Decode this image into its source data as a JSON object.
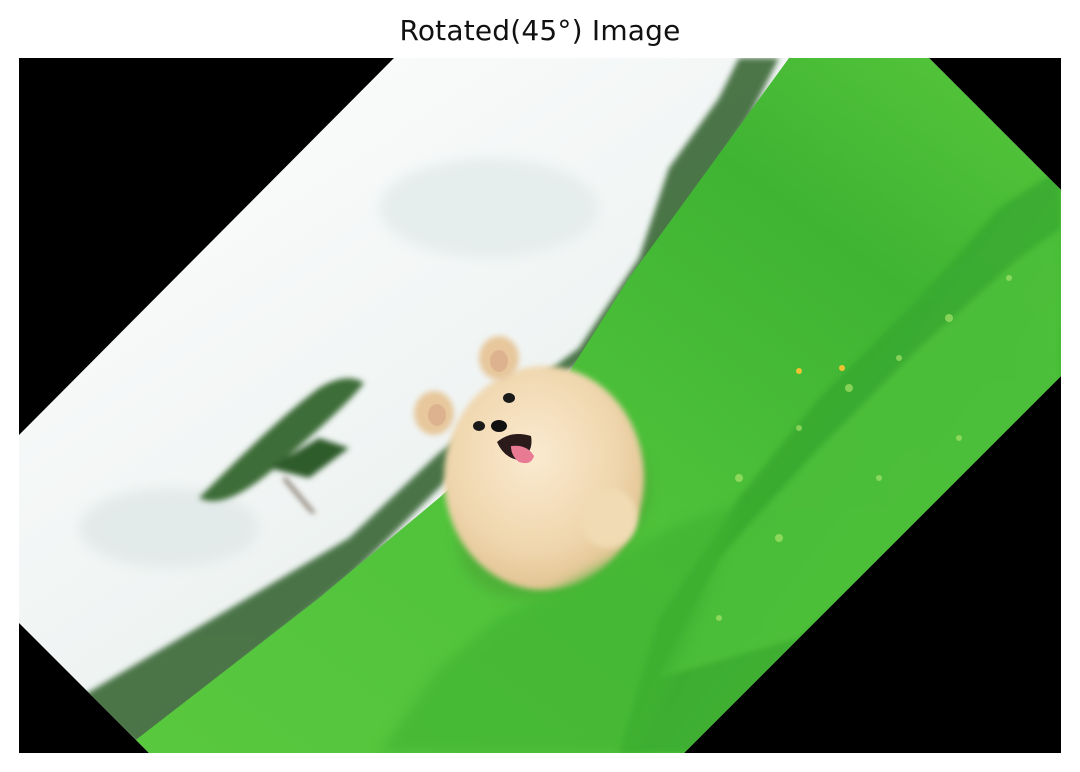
{
  "figure": {
    "title": "Rotated(45°) Image"
  },
  "image": {
    "rotation_degrees": 45,
    "background_color": "#000000",
    "subject": "pomeranian-dog",
    "scene_colors": {
      "sky": "#f4f7f6",
      "grass_light": "#7fd85a",
      "grass_mid": "#46c238",
      "grass_dark": "#2a8f25",
      "tree": "#3a6b35",
      "dog_fur": "#f2ddb9",
      "dog_tongue": "#e87a93"
    }
  }
}
